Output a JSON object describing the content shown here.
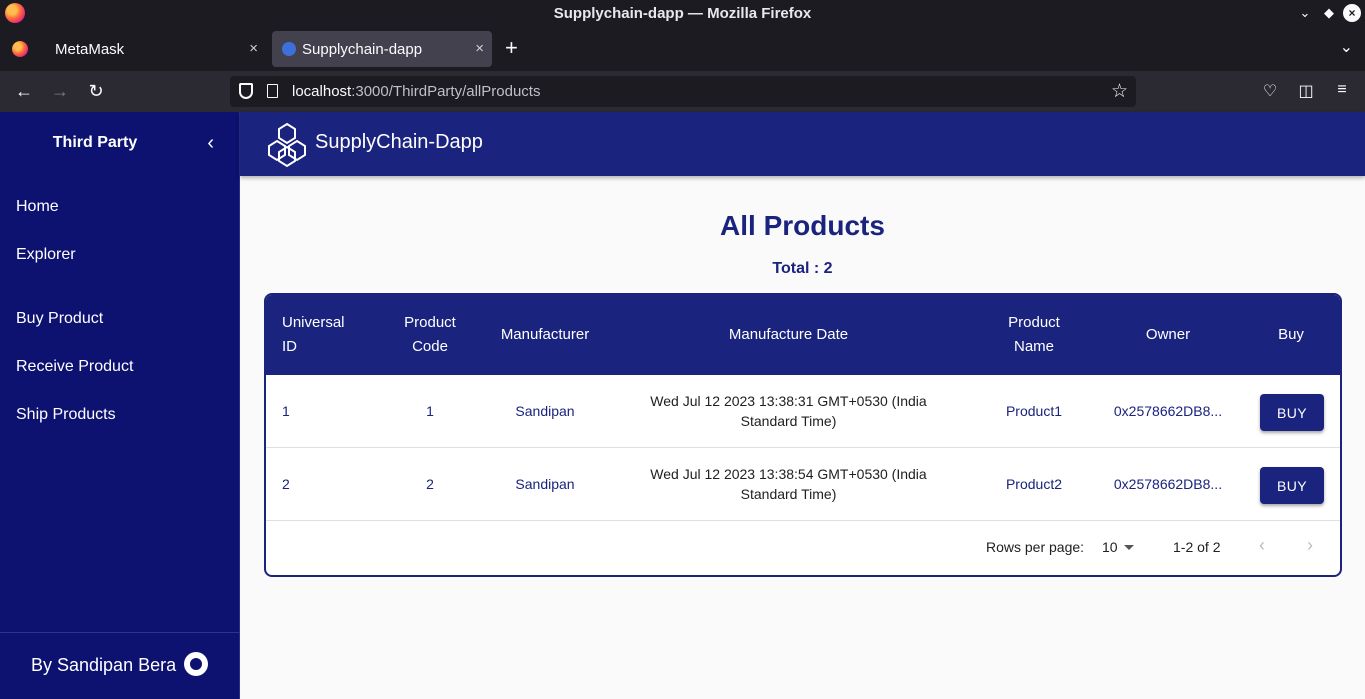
{
  "browser": {
    "window_title": "Supplychain-dapp — Mozilla Firefox",
    "tabs": [
      {
        "label": "MetaMask",
        "close": "×"
      },
      {
        "label": "Supplychain-dapp",
        "close": "×"
      }
    ],
    "url_host": "localhost",
    "url_path": ":3000/ThirdParty/allProducts"
  },
  "sidebar": {
    "title": "Third Party",
    "items": [
      {
        "label": "Home"
      },
      {
        "label": "Explorer"
      },
      {
        "label": "Buy Product"
      },
      {
        "label": "Receive Product"
      },
      {
        "label": "Ship Products"
      }
    ],
    "footer": "By Sandipan Bera"
  },
  "appbar": {
    "brand": "SupplyChain-Dapp"
  },
  "page": {
    "title": "All Products",
    "total": "Total : 2"
  },
  "table": {
    "headers": {
      "uid": "Universal ID",
      "code": "Product Code",
      "manufacturer": "Manufacturer",
      "date": "Manufacture Date",
      "name": "Product Name",
      "owner": "Owner",
      "buy": "Buy"
    },
    "rows": [
      {
        "uid": "1",
        "code": "1",
        "manufacturer": "Sandipan",
        "date": "Wed Jul 12 2023 13:38:31 GMT+0530 (India Standard Time)",
        "name": "Product1",
        "owner": "0x2578662DB8...",
        "buy": "BUY"
      },
      {
        "uid": "2",
        "code": "2",
        "manufacturer": "Sandipan",
        "date": "Wed Jul 12 2023 13:38:54 GMT+0530 (India Standard Time)",
        "name": "Product2",
        "owner": "0x2578662DB8...",
        "buy": "BUY"
      }
    ],
    "pagination": {
      "rows_per_page_label": "Rows per page:",
      "rows_per_page": "10",
      "range": "1-2 of 2"
    }
  },
  "colors": {
    "sidebar_bg": "#0d1170",
    "primary": "#1a237e",
    "content_bg": "#fafafa"
  }
}
